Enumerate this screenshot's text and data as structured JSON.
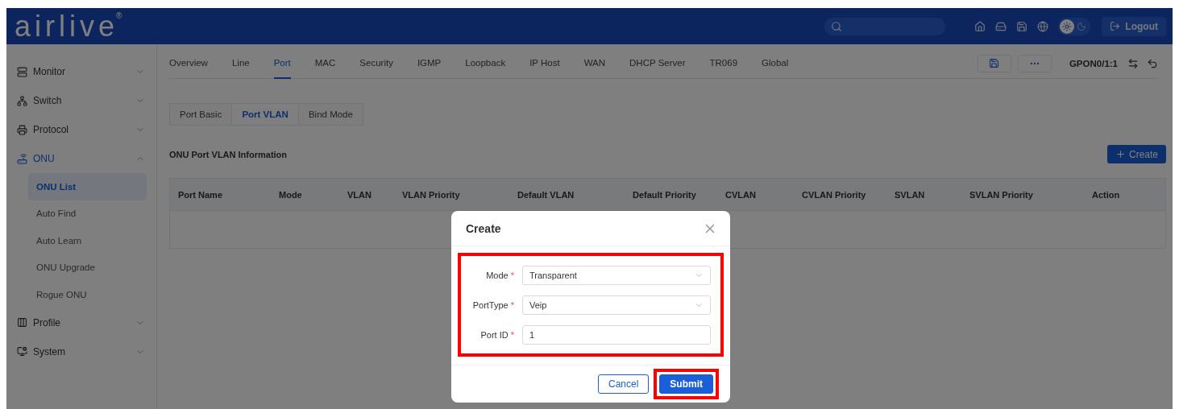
{
  "header": {
    "logo": "airlive",
    "logo_mark": "®",
    "theme": [
      {
        "kind": "light",
        "selected": true
      },
      {
        "kind": "dark",
        "selected": false
      }
    ],
    "logout": "Logout"
  },
  "sidebar": {
    "items": [
      {
        "label": "Monitor",
        "expanded": false,
        "selected": false
      },
      {
        "label": "Switch",
        "expanded": false,
        "selected": false
      },
      {
        "label": "Protocol",
        "expanded": false,
        "selected": false
      },
      {
        "label": "ONU",
        "expanded": true,
        "selected": true,
        "children": [
          {
            "label": "ONU List",
            "selected": true
          },
          {
            "label": "Auto Find",
            "selected": false
          },
          {
            "label": "Auto Learn",
            "selected": false
          },
          {
            "label": "ONU Upgrade",
            "selected": false
          },
          {
            "label": "Rogue ONU",
            "selected": false
          }
        ]
      },
      {
        "label": "Profile",
        "expanded": false,
        "selected": false
      },
      {
        "label": "System",
        "expanded": false,
        "selected": false
      }
    ]
  },
  "tabs": [
    {
      "label": "Overview",
      "selected": false
    },
    {
      "label": "Line",
      "selected": false
    },
    {
      "label": "Port",
      "selected": true
    },
    {
      "label": "MAC",
      "selected": false
    },
    {
      "label": "Security",
      "selected": false
    },
    {
      "label": "IGMP",
      "selected": false
    },
    {
      "label": "Loopback",
      "selected": false
    },
    {
      "label": "IP Host",
      "selected": false
    },
    {
      "label": "WAN",
      "selected": false
    },
    {
      "label": "DHCP Server",
      "selected": false
    },
    {
      "label": "TR069",
      "selected": false
    },
    {
      "label": "Global",
      "selected": false
    }
  ],
  "device": "GPON0/1:1",
  "subtabs": [
    {
      "label": "Port Basic",
      "selected": false
    },
    {
      "label": "Port VLAN",
      "selected": true
    },
    {
      "label": "Bind Mode",
      "selected": false
    }
  ],
  "section": {
    "title": "ONU Port VLAN Information",
    "create": "Create"
  },
  "table": {
    "columns": [
      "Port Name",
      "Mode",
      "VLAN",
      "VLAN Priority",
      "Default VLAN",
      "Default Priority",
      "CVLAN",
      "CVLAN Priority",
      "SVLAN",
      "SVLAN Priority",
      "Action"
    ]
  },
  "dialog": {
    "title": "Create",
    "fields": [
      {
        "label": "Mode",
        "required_mark": "*",
        "kind": "select",
        "value": "Transparent"
      },
      {
        "label": "PortType",
        "required_mark": "*",
        "kind": "select",
        "value": "Veip"
      },
      {
        "label": "Port ID",
        "required_mark": "*",
        "kind": "input",
        "value": "1"
      }
    ],
    "buttons": [
      {
        "label": "Cancel",
        "kind": "default"
      },
      {
        "label": "Submit",
        "kind": "primary"
      }
    ]
  }
}
